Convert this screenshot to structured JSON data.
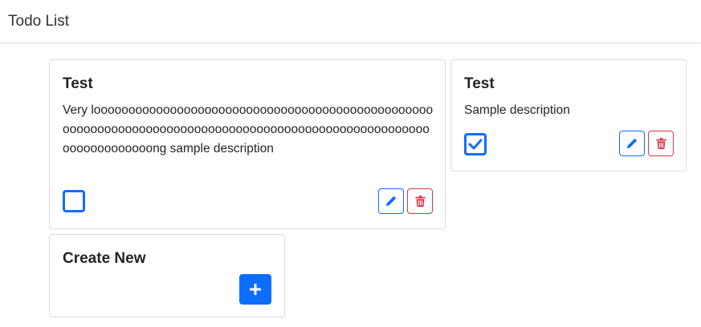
{
  "navbar": {
    "title": "Todo List"
  },
  "colors": {
    "primary": "#0d6efd",
    "danger": "#dc3545"
  },
  "todos": [
    {
      "title": "Test",
      "description": "Very looooooooooooooooooooooooooooooooooooooooooooooooooooooooooooooooooooooooooooooooooooooooooooooooooooooooooooooooooong sample description",
      "completed": false,
      "edit_icon": "pencil-icon",
      "delete_icon": "trash-icon"
    },
    {
      "title": "Test",
      "description": "Sample description",
      "completed": true,
      "edit_icon": "pencil-icon",
      "delete_icon": "trash-icon"
    }
  ],
  "create_card": {
    "title": "Create New",
    "button_icon": "plus-icon"
  }
}
